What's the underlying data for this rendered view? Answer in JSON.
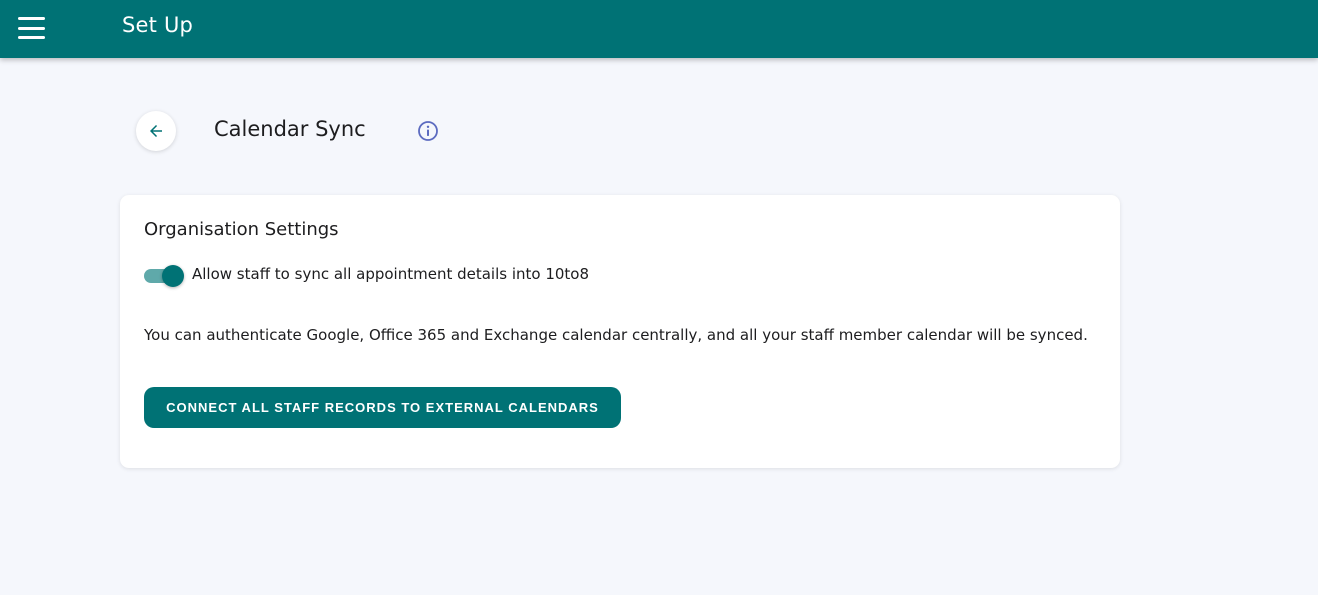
{
  "app_bar": {
    "title": "Set Up",
    "menu_icon": "hamburger-menu-icon"
  },
  "header": {
    "back_icon": "arrow-left-icon",
    "title": "Calendar Sync",
    "info_icon": "info-circle-icon"
  },
  "organisation_settings": {
    "title": "Organisation Settings",
    "sync_toggle": {
      "label": "Allow staff to sync all appointment details into 10to8",
      "state": "on"
    },
    "description": "You can authenticate Google, Office 365 and Exchange calendar centrally, and all your staff member calendar will be synced.",
    "connect_button_label": "CONNECT ALL STAFF RECORDS TO EXTERNAL CALENDARS"
  },
  "colors": {
    "primary": "#007275",
    "toggle_track": "#5fa9aa",
    "info_icon": "#5c6bc0",
    "background": "#f5f7fc"
  }
}
